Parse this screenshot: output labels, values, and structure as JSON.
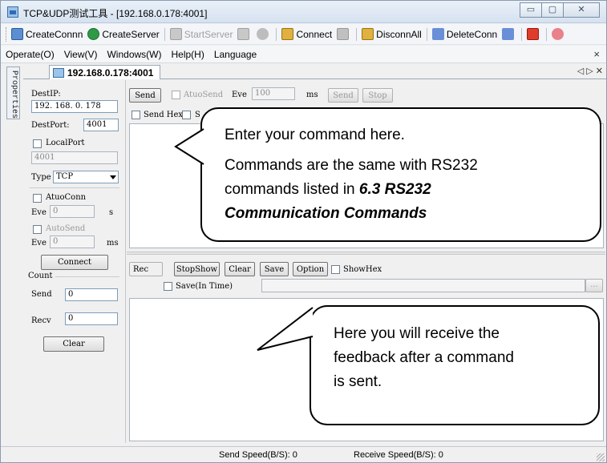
{
  "window": {
    "title": "TCP&UDP测试工具 - [192.168.0.178:4001]"
  },
  "titlebar_buttons": {
    "minimize": "▭",
    "maximize": "▢",
    "close": "✕"
  },
  "toolbar": {
    "items": [
      {
        "label": "CreateConnn",
        "icon": "create-conn-icon",
        "disabled": false
      },
      {
        "label": "CreateServer",
        "icon": "create-server-icon",
        "disabled": false
      },
      {
        "label": "StartServer",
        "icon": "start-server-icon",
        "disabled": true
      },
      {
        "label": "Connect",
        "icon": "connect-icon",
        "disabled": false
      },
      {
        "label": "DisconnAll",
        "icon": "disconnect-all-icon",
        "disabled": false
      },
      {
        "label": "DeleteConn",
        "icon": "delete-conn-icon",
        "disabled": false
      }
    ]
  },
  "menu": {
    "items": [
      "Operate(O)",
      "View(V)",
      "Windows(W)",
      "Help(H)",
      "Language"
    ],
    "close_glyph": "×"
  },
  "side_tab": {
    "label": "Properties"
  },
  "doc_tab": {
    "label": "192.168.0.178:4001",
    "controls": "◁ ▷ ✕"
  },
  "left_panel": {
    "dest_ip_label": "DestIP:",
    "dest_ip_value": "192. 168. 0. 178",
    "dest_port_label": "DestPort:",
    "dest_port_value": "4001",
    "local_port_label": "LocalPort",
    "local_port_value": "4001",
    "type_label": "Type",
    "type_value": "TCP",
    "auto_conn_label": "AtuoConn",
    "eve_label": "Eve",
    "eve_conn_value": "0",
    "eve_conn_unit": "s",
    "auto_send_label": "AutoSend",
    "eve_send_value": "0",
    "eve_send_unit": "ms",
    "connect_button": "Connect",
    "count_label": "Count",
    "send_label": "Send",
    "send_value": "0",
    "recv_label": "Recv",
    "recv_value": "0",
    "clear_button": "Clear"
  },
  "send_panel": {
    "send_button": "Send",
    "auto_send_label": "AtuoSend",
    "eve_label": "Eve",
    "eve_value": "100",
    "unit": "ms",
    "send_button_2": "Send",
    "stop_button": "Stop",
    "send_hex_label": "Send Hex",
    "partial_label": "S"
  },
  "recv_panel": {
    "rec_label": "Rec",
    "stop_show_button": "StopShow",
    "clear_button": "Clear",
    "save_button": "Save",
    "option_button": "Option",
    "show_hex_label": "ShowHex",
    "save_in_time_label": "Save(In Time)",
    "browse_button": "..."
  },
  "status": {
    "send_speed": "Send Speed(B/S): 0",
    "receive_speed": "Receive Speed(B/S): 0"
  },
  "callouts": {
    "command": {
      "line1": "Enter your command here.",
      "line2": "Commands are the same with RS232",
      "line3_prefix": "commands listed in ",
      "line3_emph": "6.3 RS232",
      "line4": "Communication Commands"
    },
    "feedback": {
      "line1": "Here you will receive the",
      "line2": "feedback after a command",
      "line3": "is sent."
    }
  }
}
